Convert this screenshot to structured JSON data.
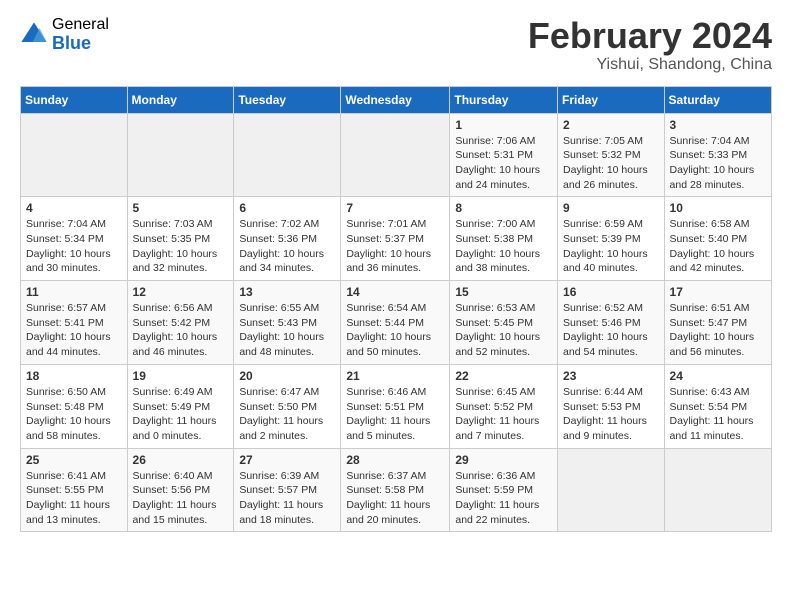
{
  "logo": {
    "general": "General",
    "blue": "Blue"
  },
  "title": {
    "month_year": "February 2024",
    "location": "Yishui, Shandong, China"
  },
  "headers": [
    "Sunday",
    "Monday",
    "Tuesday",
    "Wednesday",
    "Thursday",
    "Friday",
    "Saturday"
  ],
  "weeks": [
    [
      {
        "day": "",
        "detail": ""
      },
      {
        "day": "",
        "detail": ""
      },
      {
        "day": "",
        "detail": ""
      },
      {
        "day": "",
        "detail": ""
      },
      {
        "day": "1",
        "detail": "Sunrise: 7:06 AM\nSunset: 5:31 PM\nDaylight: 10 hours and 24 minutes."
      },
      {
        "day": "2",
        "detail": "Sunrise: 7:05 AM\nSunset: 5:32 PM\nDaylight: 10 hours and 26 minutes."
      },
      {
        "day": "3",
        "detail": "Sunrise: 7:04 AM\nSunset: 5:33 PM\nDaylight: 10 hours and 28 minutes."
      }
    ],
    [
      {
        "day": "4",
        "detail": "Sunrise: 7:04 AM\nSunset: 5:34 PM\nDaylight: 10 hours and 30 minutes."
      },
      {
        "day": "5",
        "detail": "Sunrise: 7:03 AM\nSunset: 5:35 PM\nDaylight: 10 hours and 32 minutes."
      },
      {
        "day": "6",
        "detail": "Sunrise: 7:02 AM\nSunset: 5:36 PM\nDaylight: 10 hours and 34 minutes."
      },
      {
        "day": "7",
        "detail": "Sunrise: 7:01 AM\nSunset: 5:37 PM\nDaylight: 10 hours and 36 minutes."
      },
      {
        "day": "8",
        "detail": "Sunrise: 7:00 AM\nSunset: 5:38 PM\nDaylight: 10 hours and 38 minutes."
      },
      {
        "day": "9",
        "detail": "Sunrise: 6:59 AM\nSunset: 5:39 PM\nDaylight: 10 hours and 40 minutes."
      },
      {
        "day": "10",
        "detail": "Sunrise: 6:58 AM\nSunset: 5:40 PM\nDaylight: 10 hours and 42 minutes."
      }
    ],
    [
      {
        "day": "11",
        "detail": "Sunrise: 6:57 AM\nSunset: 5:41 PM\nDaylight: 10 hours and 44 minutes."
      },
      {
        "day": "12",
        "detail": "Sunrise: 6:56 AM\nSunset: 5:42 PM\nDaylight: 10 hours and 46 minutes."
      },
      {
        "day": "13",
        "detail": "Sunrise: 6:55 AM\nSunset: 5:43 PM\nDaylight: 10 hours and 48 minutes."
      },
      {
        "day": "14",
        "detail": "Sunrise: 6:54 AM\nSunset: 5:44 PM\nDaylight: 10 hours and 50 minutes."
      },
      {
        "day": "15",
        "detail": "Sunrise: 6:53 AM\nSunset: 5:45 PM\nDaylight: 10 hours and 52 minutes."
      },
      {
        "day": "16",
        "detail": "Sunrise: 6:52 AM\nSunset: 5:46 PM\nDaylight: 10 hours and 54 minutes."
      },
      {
        "day": "17",
        "detail": "Sunrise: 6:51 AM\nSunset: 5:47 PM\nDaylight: 10 hours and 56 minutes."
      }
    ],
    [
      {
        "day": "18",
        "detail": "Sunrise: 6:50 AM\nSunset: 5:48 PM\nDaylight: 10 hours and 58 minutes."
      },
      {
        "day": "19",
        "detail": "Sunrise: 6:49 AM\nSunset: 5:49 PM\nDaylight: 11 hours and 0 minutes."
      },
      {
        "day": "20",
        "detail": "Sunrise: 6:47 AM\nSunset: 5:50 PM\nDaylight: 11 hours and 2 minutes."
      },
      {
        "day": "21",
        "detail": "Sunrise: 6:46 AM\nSunset: 5:51 PM\nDaylight: 11 hours and 5 minutes."
      },
      {
        "day": "22",
        "detail": "Sunrise: 6:45 AM\nSunset: 5:52 PM\nDaylight: 11 hours and 7 minutes."
      },
      {
        "day": "23",
        "detail": "Sunrise: 6:44 AM\nSunset: 5:53 PM\nDaylight: 11 hours and 9 minutes."
      },
      {
        "day": "24",
        "detail": "Sunrise: 6:43 AM\nSunset: 5:54 PM\nDaylight: 11 hours and 11 minutes."
      }
    ],
    [
      {
        "day": "25",
        "detail": "Sunrise: 6:41 AM\nSunset: 5:55 PM\nDaylight: 11 hours and 13 minutes."
      },
      {
        "day": "26",
        "detail": "Sunrise: 6:40 AM\nSunset: 5:56 PM\nDaylight: 11 hours and 15 minutes."
      },
      {
        "day": "27",
        "detail": "Sunrise: 6:39 AM\nSunset: 5:57 PM\nDaylight: 11 hours and 18 minutes."
      },
      {
        "day": "28",
        "detail": "Sunrise: 6:37 AM\nSunset: 5:58 PM\nDaylight: 11 hours and 20 minutes."
      },
      {
        "day": "29",
        "detail": "Sunrise: 6:36 AM\nSunset: 5:59 PM\nDaylight: 11 hours and 22 minutes."
      },
      {
        "day": "",
        "detail": ""
      },
      {
        "day": "",
        "detail": ""
      }
    ]
  ]
}
